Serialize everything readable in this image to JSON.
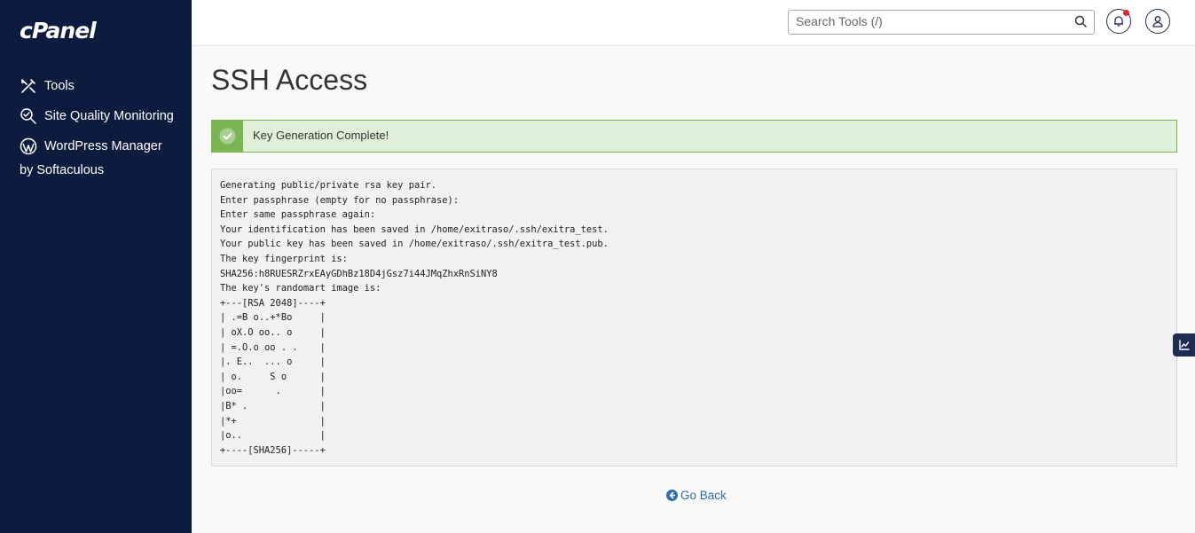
{
  "sidebar": {
    "logo": "cPanel",
    "items": [
      {
        "label": "Tools",
        "icon": "tools-icon"
      },
      {
        "label": "Site Quality Monitoring",
        "icon": "site-quality-icon"
      },
      {
        "label": "WordPress Manager by Softaculous",
        "icon": "wordpress-icon"
      }
    ]
  },
  "header": {
    "search_placeholder": "Search Tools (/)",
    "notification_icon": "bell-icon",
    "user_icon": "user-icon"
  },
  "main": {
    "title": "SSH Access",
    "alert": {
      "text": "Key Generation Complete!",
      "status": "success",
      "color": "#79b552"
    },
    "console_output": "Generating public/private rsa key pair.\nEnter passphrase (empty for no passphrase):\nEnter same passphrase again:\nYour identification has been saved in /home/exitraso/.ssh/exitra_test.\nYour public key has been saved in /home/exitraso/.ssh/exitra_test.pub.\nThe key fingerprint is:\nSHA256:h8RUESRZrxEAyGDhBz18D4jGsz7i44JMqZhxRnSiNY8\nThe key's randomart image is:\n+---[RSA 2048]----+\n| .=B o..+*Bo     |\n| oX.O oo.. o     |\n| =.O.o oo . .    |\n|. E..  ... o     |\n| o.     S o      |\n|oo=      .       |\n|B* .             |\n|*+               |\n|o..              |\n+----[SHA256]-----+",
    "go_back_label": "Go Back"
  },
  "colors": {
    "sidebar_bg": "#0d1b3e",
    "accent": "#2f6fa7",
    "notification_dot": "#e0242f"
  }
}
